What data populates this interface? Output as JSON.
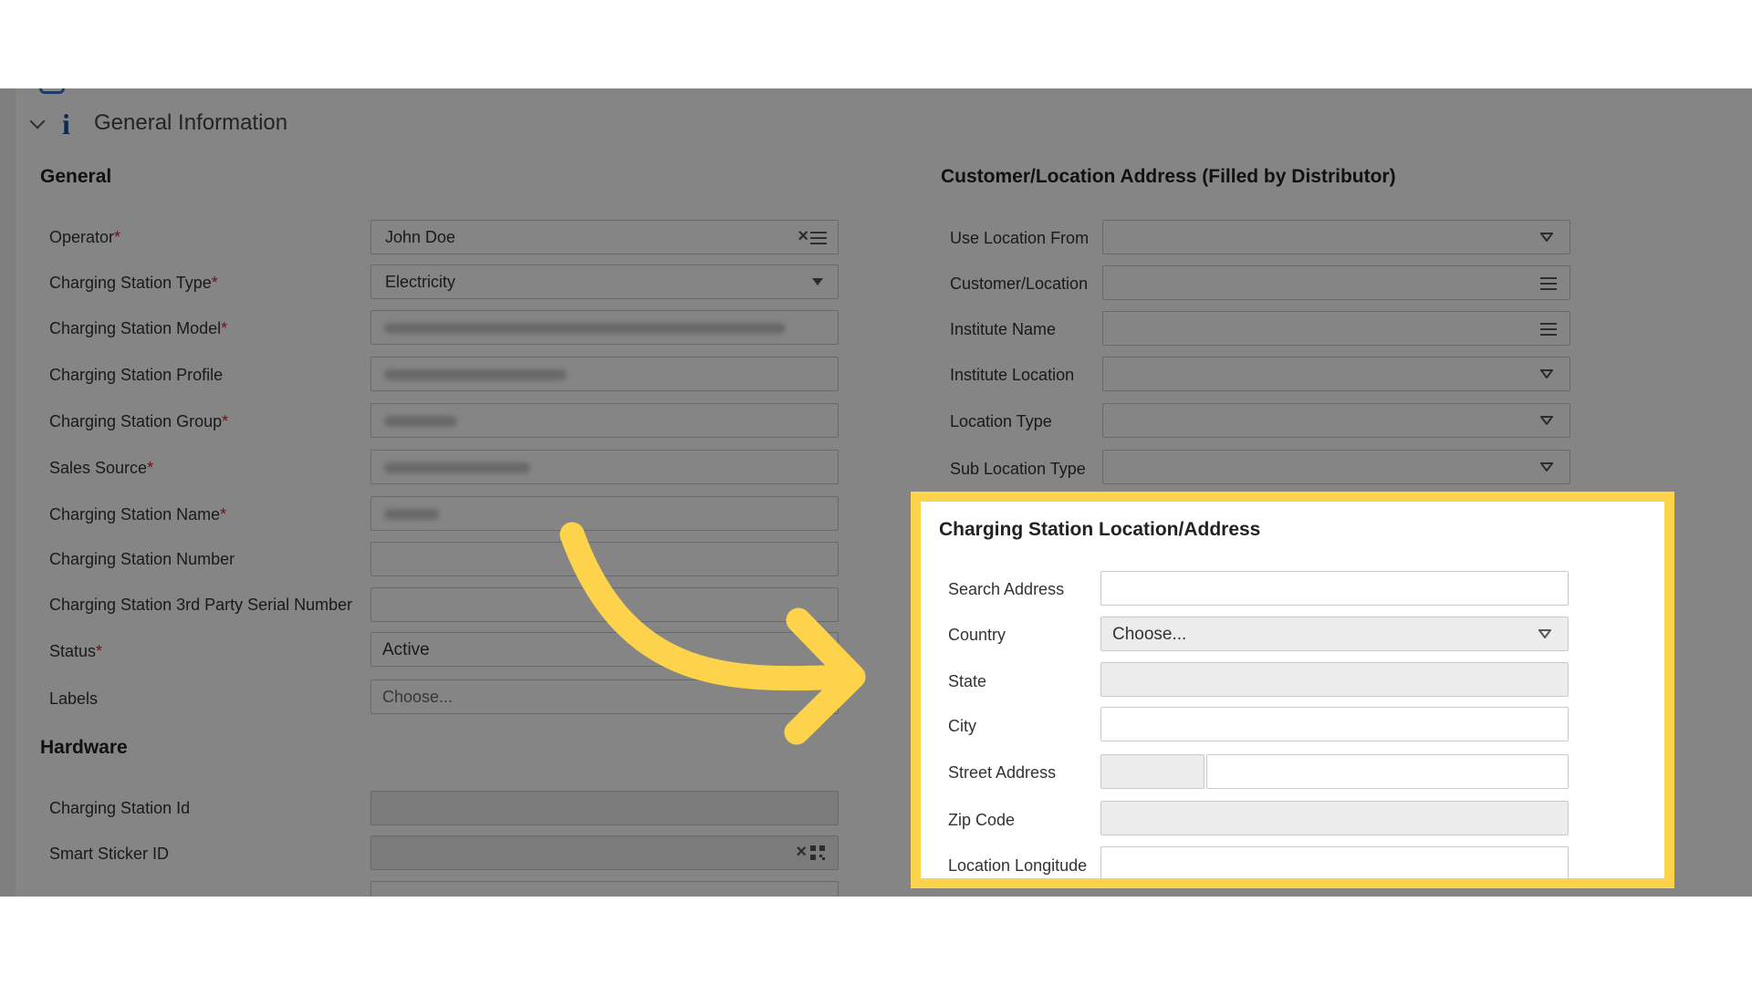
{
  "section_header": {
    "title": "General Information"
  },
  "general": {
    "title": "General",
    "operator": {
      "label": "Operator",
      "value": "John Doe"
    },
    "station_type": {
      "label": "Charging Station Type",
      "value": "Electricity"
    },
    "station_model": {
      "label": "Charging Station Model"
    },
    "station_profile": {
      "label": "Charging Station Profile"
    },
    "station_group": {
      "label": "Charging Station Group"
    },
    "sales_source": {
      "label": "Sales Source"
    },
    "station_name": {
      "label": "Charging Station Name"
    },
    "station_number": {
      "label": "Charging Station Number"
    },
    "third_party_serial": {
      "label": "Charging Station 3rd Party Serial Number"
    },
    "status": {
      "label": "Status",
      "value": "Active"
    },
    "labels": {
      "label": "Labels",
      "placeholder": "Choose..."
    },
    "required_mark": "*"
  },
  "hardware": {
    "title": "Hardware",
    "station_id": {
      "label": "Charging Station Id"
    },
    "smart_sticker": {
      "label": "Smart Sticker ID"
    }
  },
  "customer_address": {
    "title": "Customer/Location Address (Filled by Distributor)",
    "use_location_from": {
      "label": "Use Location From"
    },
    "customer_location": {
      "label": "Customer/Location"
    },
    "institute_name": {
      "label": "Institute Name"
    },
    "institute_location": {
      "label": "Institute Location"
    },
    "location_type": {
      "label": "Location Type"
    },
    "sub_location_type": {
      "label": "Sub Location Type"
    }
  },
  "station_address": {
    "title": "Charging Station Location/Address",
    "search_address": {
      "label": "Search Address"
    },
    "country": {
      "label": "Country",
      "placeholder": "Choose..."
    },
    "state": {
      "label": "State"
    },
    "city": {
      "label": "City"
    },
    "street_address": {
      "label": "Street Address"
    },
    "zip_code": {
      "label": "Zip Code"
    },
    "longitude": {
      "label": "Location Longitude"
    }
  },
  "icons": {
    "clear": "×",
    "list": "list-icon",
    "qr": "qr-code-icon",
    "dropdown": "caret-down-icon",
    "info": "i"
  },
  "colors": {
    "highlight_border": "#fcd34a",
    "arrow": "#fcd34a",
    "required": "#d9212a",
    "info_icon": "#1d4f9c"
  }
}
